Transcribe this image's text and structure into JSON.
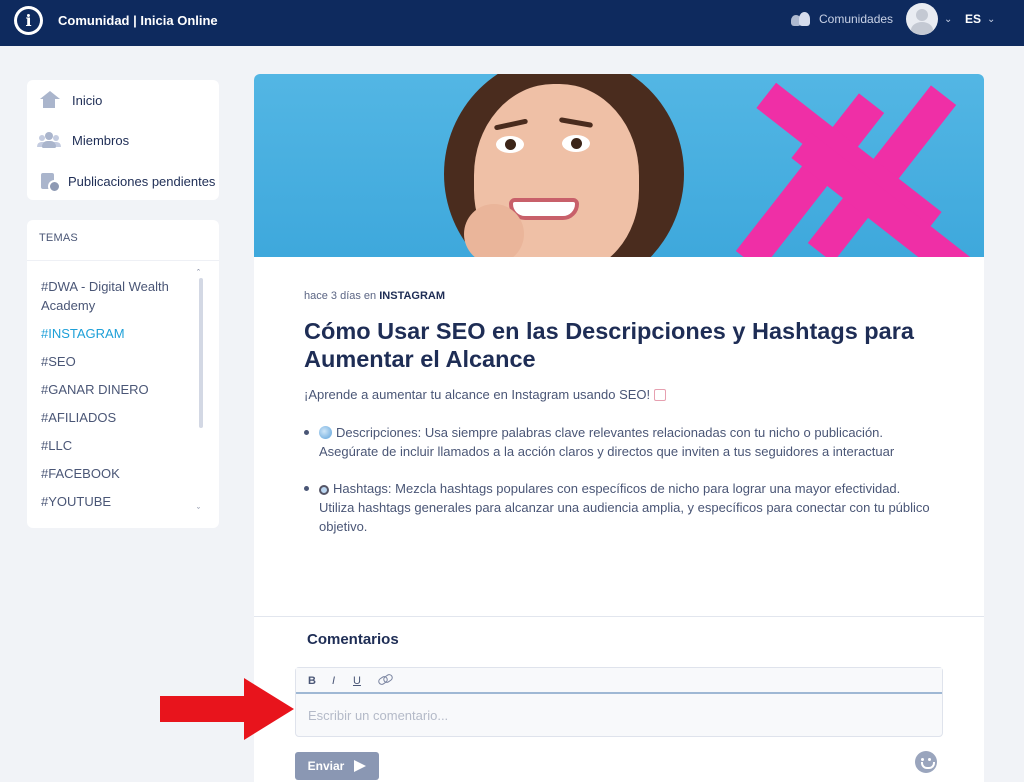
{
  "header": {
    "brand": "Comunidad | Inicia Online",
    "communities_label": "Comunidades",
    "language": "ES"
  },
  "sidebar": {
    "nav": [
      {
        "label": "Inicio",
        "icon": "home-icon"
      },
      {
        "label": "Miembros",
        "icon": "users-icon"
      },
      {
        "label": "Publicaciones pendientes",
        "icon": "docs-icon"
      }
    ],
    "topics_title": "TEMAS",
    "topics": [
      {
        "label": "#DWA - Digital Wealth Academy",
        "active": false
      },
      {
        "label": "#INSTAGRAM",
        "active": true
      },
      {
        "label": "#SEO",
        "active": false
      },
      {
        "label": "#GANAR DINERO",
        "active": false
      },
      {
        "label": "#AFILIADOS",
        "active": false
      },
      {
        "label": "#LLC",
        "active": false
      },
      {
        "label": "#FACEBOOK",
        "active": false
      },
      {
        "label": "#YOUTUBE",
        "active": false
      }
    ]
  },
  "post": {
    "meta_prefix": "hace 3 días en ",
    "meta_category": "INSTAGRAM",
    "title": "Cómo Usar SEO en las Descripciones y Hashtags para Aumentar el Alcance",
    "intro": "¡Aprende a aumentar tu alcance en Instagram usando SEO!",
    "bullets": [
      {
        "icon": "globe-emoji-icon",
        "text": "Descripciones: Usa siempre palabras clave relevantes relacionadas con tu nicho o publicación. Asegúrate de incluir llamados a la acción claros y directos que inviten a tus seguidores a interactuar"
      },
      {
        "icon": "magnifier-emoji-icon",
        "text": "Hashtags: Mezcla hashtags populares con específicos de nicho para lograr una mayor efectividad. Utiliza hashtags generales para alcanzar una audiencia amplia, y específicos para conectar con tu público objetivo."
      }
    ]
  },
  "comments": {
    "title": "Comentarios",
    "toolbar": {
      "bold": "B",
      "italic": "I",
      "underline": "U"
    },
    "placeholder": "Escribir un comentario...",
    "send_label": "Enviar"
  },
  "colors": {
    "topbar": "#0e2a5e",
    "accent_active_topic": "#1ea0d8",
    "send_button": "#8a97b3",
    "annotation_arrow": "#e8141c"
  }
}
